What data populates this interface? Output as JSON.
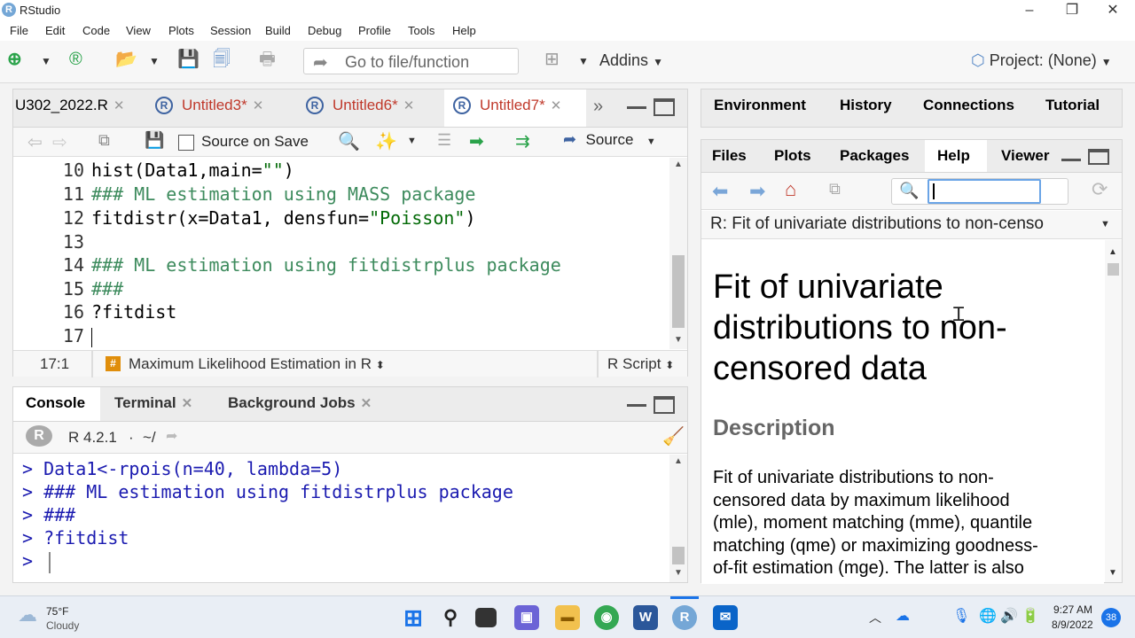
{
  "window": {
    "title": "RStudio",
    "logo_letter": "R",
    "minimize": "–",
    "restore": "❐",
    "close": "✕"
  },
  "menu": [
    "File",
    "Edit",
    "Code",
    "View",
    "Plots",
    "Session",
    "Build",
    "Debug",
    "Profile",
    "Tools",
    "Help"
  ],
  "toolbar": {
    "goto_placeholder": "Go to file/function",
    "addins_label": "Addins",
    "project_label": "Project: (None)"
  },
  "source": {
    "tabs": [
      {
        "label": "U302_2022.R",
        "unsaved": false,
        "active": false
      },
      {
        "label": "Untitled3*",
        "unsaved": true,
        "active": false
      },
      {
        "label": "Untitled6*",
        "unsaved": true,
        "active": false
      },
      {
        "label": "Untitled7*",
        "unsaved": true,
        "active": true
      }
    ],
    "source_on_save_label": "Source on Save",
    "source_button_label": "Source",
    "lines": [
      {
        "num": "10",
        "text": "hist(Data1,main=\"\")",
        "kind": "code"
      },
      {
        "num": "11",
        "text": "### ML estimation using MASS package",
        "kind": "comment"
      },
      {
        "num": "12",
        "text": "fitdistr(x=Data1, densfun=\"Poisson\")",
        "kind": "code"
      },
      {
        "num": "13",
        "text": "",
        "kind": "code"
      },
      {
        "num": "14",
        "text": "### ML estimation using fitdistrplus package",
        "kind": "comment"
      },
      {
        "num": "15",
        "text": "###",
        "kind": "comment"
      },
      {
        "num": "16",
        "text": "?fitdist",
        "kind": "code"
      },
      {
        "num": "17",
        "text": "",
        "kind": "code"
      }
    ],
    "status": {
      "cursor_pos": "17:1",
      "section_icon": "#",
      "section_label": "Maximum Likelihood Estimation in R",
      "file_type": "R Script"
    }
  },
  "console": {
    "tabs": [
      {
        "label": "Console",
        "closable": false,
        "active": true
      },
      {
        "label": "Terminal",
        "closable": true,
        "active": false
      },
      {
        "label": "Background Jobs",
        "closable": true,
        "active": false
      }
    ],
    "r_version": "R 4.2.1",
    "working_dir": "~/",
    "lines": [
      "> Data1<-rpois(n=40, lambda=5)",
      "> ### ML estimation using fitdistrplus package",
      "> ###",
      "> ?fitdist",
      "> "
    ]
  },
  "env_pane": {
    "tabs": [
      "Environment",
      "History",
      "Connections",
      "Tutorial"
    ]
  },
  "help_pane": {
    "tabs": [
      "Files",
      "Plots",
      "Packages",
      "Help",
      "Viewer"
    ],
    "active_tab": "Help",
    "topic": "R: Fit of univariate distributions to non-censo",
    "title_lines": [
      "Fit of univariate",
      "distributions to non-",
      "censored data"
    ],
    "section_heading": "Description",
    "description_lines": [
      "Fit of univariate distributions to non-",
      "censored data by maximum likelihood",
      "(mle), moment matching (mme), quantile",
      "matching (qme) or maximizing goodness-",
      "of-fit estimation (mge). The latter is also"
    ]
  },
  "taskbar": {
    "weather_temp": "75°F",
    "weather_desc": "Cloudy",
    "time": "9:27 AM",
    "date": "8/9/2022",
    "notification_count": "38"
  },
  "colors": {
    "accent": "#1a73e8",
    "comment": "#3d8b5d",
    "console_text": "#1b1bb0",
    "tab_unsaved": "#c0392b"
  }
}
